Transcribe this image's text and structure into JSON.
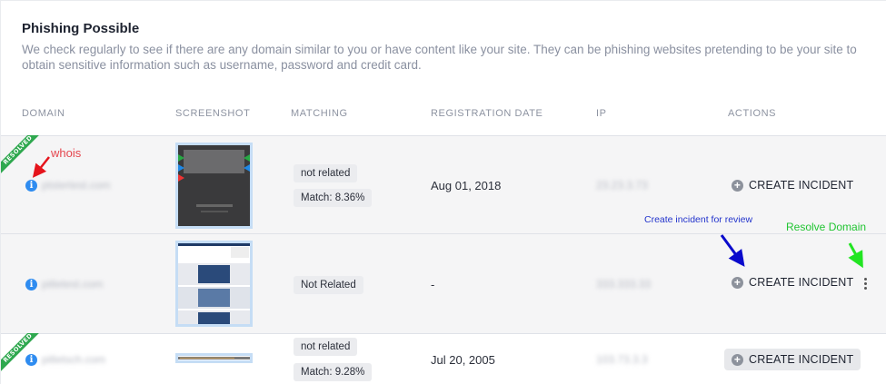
{
  "section": {
    "title": "Phishing Possible",
    "description": "We check regularly to see if there are any domain similar to you or have content like your site. They can be phishing websites pretending to be your site to obtain sensitive information such as username, password and credit card."
  },
  "table": {
    "headers": [
      "DOMAIN",
      "SCREENSHOT",
      "MATCHING",
      "REGISTRATION DATE",
      "IP",
      "ACTIONS"
    ],
    "rows": [
      {
        "status": "RESOLVED",
        "domain": "ptstertest.com",
        "matching": "not related",
        "match_score": "Match: 8.36%",
        "registration_date": "Aug 01, 2018",
        "ip": "23.23.3.73",
        "action": "CREATE INCIDENT"
      },
      {
        "status": "",
        "domain": "pitletest.com",
        "matching": "Not Related",
        "match_score": "",
        "registration_date": "-",
        "ip": "333.333.33",
        "action": "CREATE INCIDENT"
      },
      {
        "status": "RESOLVED",
        "domain": "pitletsch.com",
        "matching": "not related",
        "match_score": "Match: 9.28%",
        "registration_date": "Jul 20, 2005",
        "ip": "103.73.3.3",
        "action": "CREATE INCIDENT"
      }
    ]
  },
  "annotations": {
    "whois": "whois",
    "create_incident": "Create incident for review",
    "resolve_domain": "Resolve Domain"
  },
  "colors": {
    "resolved_ribbon": "#2fa84f",
    "info_icon": "#2f8cf0",
    "arrow_red": "#e5141c",
    "arrow_blue": "#0a0acc",
    "arrow_green": "#22e522"
  }
}
